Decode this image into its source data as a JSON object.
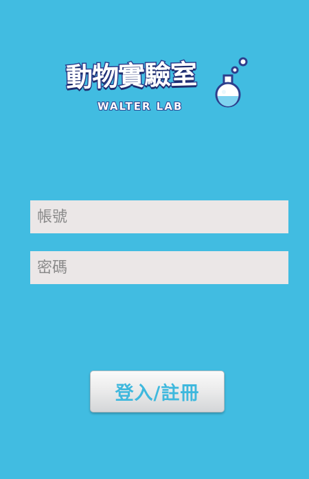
{
  "app": {
    "title": "動物實驗室",
    "subtitle": "WALTER LAB"
  },
  "login_form": {
    "account_placeholder": "帳號",
    "account_value": "",
    "password_placeholder": "密碼",
    "password_value": "",
    "submit_label": "登入/註冊"
  },
  "icons": {
    "logo_decoration": "flask-icon"
  },
  "colors": {
    "background": "#41bce1",
    "field_background": "#ebe7e7",
    "button_text": "#3fb8dd",
    "logo_outline": "#2d3e8c"
  }
}
